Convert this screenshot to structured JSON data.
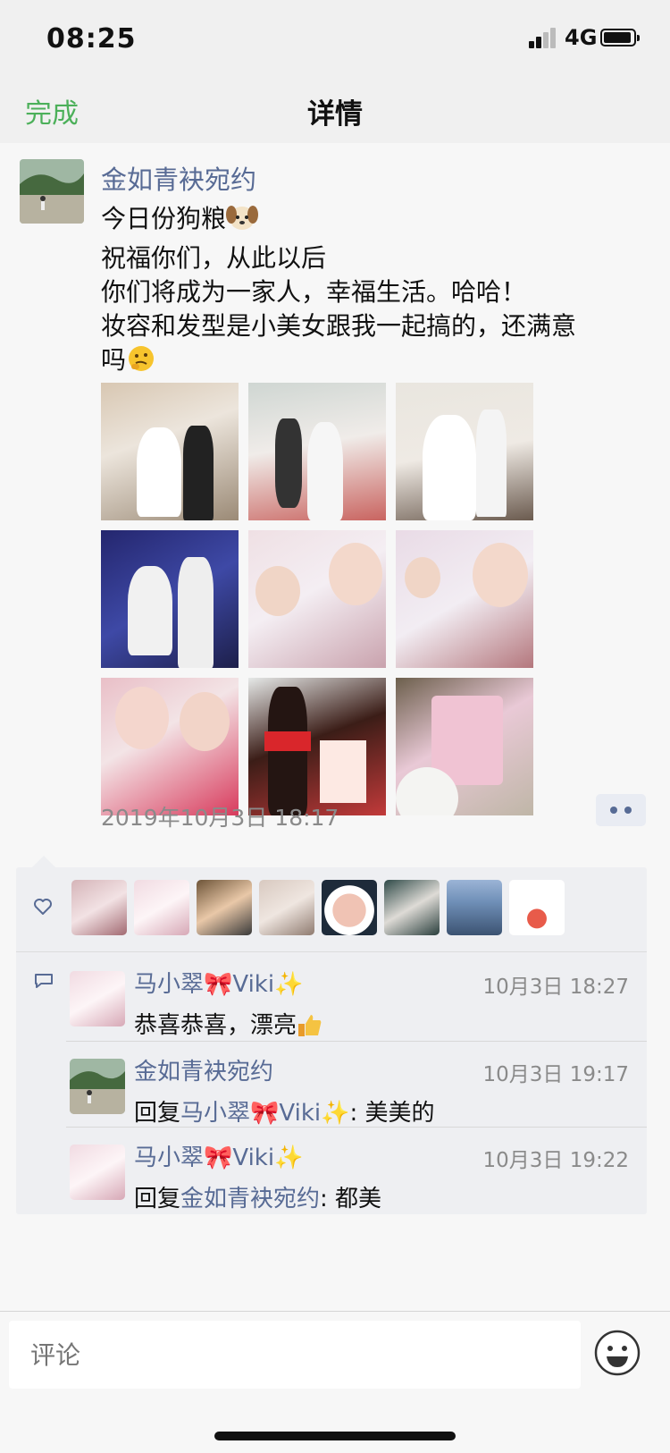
{
  "status_bar": {
    "time": "08:25",
    "network": "4G"
  },
  "nav": {
    "done_label": "完成",
    "title": "详情"
  },
  "post": {
    "author": "金如青袂宛约",
    "text_lines": [
      "今日份狗粮",
      "祝福你们，从此以后",
      "你们将成为一家人，幸福生活。哈哈！",
      "妆容和发型是小美女跟我一起搞的，还满意",
      "吗"
    ],
    "text_emojis": [
      "dog-face-emoji",
      "thinking-face-emoji"
    ],
    "photos_count": 9,
    "timestamp": "2019年10月3日 18:17"
  },
  "likes": {
    "icon": "heart-icon",
    "count": 8
  },
  "comments": [
    {
      "author": "马小翠🎀Viki✨",
      "time": "10月3日 18:27",
      "text": "恭喜恭喜，漂亮",
      "text_emoji": "thumbs-up-emoji"
    },
    {
      "author": "金如青袂宛约",
      "time": "10月3日 19:17",
      "reply_prefix": "回复",
      "reply_to": "马小翠🎀Viki✨",
      "text": ": 美美的"
    },
    {
      "author": "马小翠🎀Viki✨",
      "time": "10月3日 19:22",
      "reply_prefix": "回复",
      "reply_to": "金如青袂宛约",
      "text": ": 都美"
    }
  ],
  "input": {
    "placeholder": "评论"
  },
  "colors": {
    "link": "#586b95",
    "accent": "#4cb05a",
    "panel": "#eeeff2"
  }
}
